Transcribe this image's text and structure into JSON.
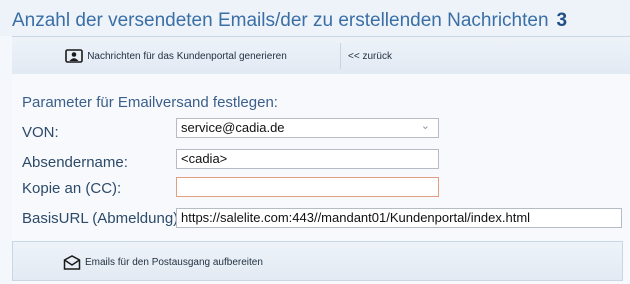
{
  "header": {
    "title": "Anzahl der versendeten Emails/der zu erstellenden Nachrichten",
    "count": "3"
  },
  "toolbar": {
    "generate_label": "Nachrichten für das Kundenportal generieren",
    "generate_icon": "contact-card-icon",
    "back_label": "<< zurück"
  },
  "form": {
    "heading": "Parameter für Emailversand festlegen:",
    "from_label": "VON:",
    "from_value": "service@cadia.de",
    "sender_label": "Absendername:",
    "sender_value": "<cadia>",
    "cc_label": "Kopie an (CC):",
    "cc_value": "",
    "baseurl_label": "BasisURL (Abmeldung):",
    "baseurl_value": "https://salelite.com:443//mandant01/Kundenportal/index.html"
  },
  "footer": {
    "prepare_label": "Emails für den Postausgang aufbereiten",
    "prepare_icon": "envelope-icon"
  },
  "colors": {
    "title": "#3a6fa6",
    "focus_border": "#e0a080"
  }
}
